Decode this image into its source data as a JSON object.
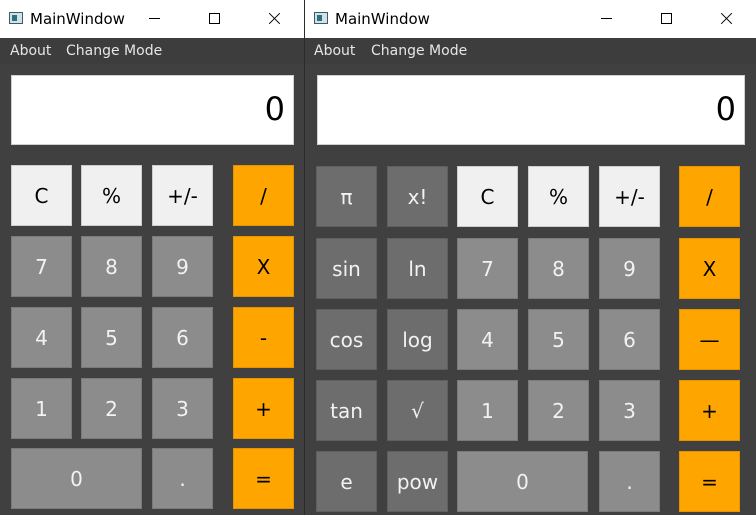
{
  "colors": {
    "accent_orange": "#FFA500",
    "button_gray": "#8C8C8C",
    "button_dark": "#6D6D6D",
    "button_light": "#F0F0F0",
    "window_bg": "#404040"
  },
  "left_window": {
    "title": "MainWindow",
    "menu": [
      "About",
      "Change Mode"
    ],
    "display": "0",
    "buttons": [
      "C",
      "%",
      "+/-",
      "/",
      "7",
      "8",
      "9",
      "X",
      "4",
      "5",
      "6",
      "-",
      "1",
      "2",
      "3",
      "+",
      "0",
      ".",
      "="
    ]
  },
  "right_window": {
    "title": "MainWindow",
    "menu": [
      "About",
      "Change Mode"
    ],
    "display": "0",
    "buttons": [
      "π",
      "x!",
      "C",
      "%",
      "+/-",
      "/",
      "sin",
      "ln",
      "7",
      "8",
      "9",
      "X",
      "cos",
      "log",
      "4",
      "5",
      "6",
      "—",
      "tan",
      "√",
      "1",
      "2",
      "3",
      "+",
      "e",
      "pow",
      "0",
      ".",
      "="
    ]
  }
}
